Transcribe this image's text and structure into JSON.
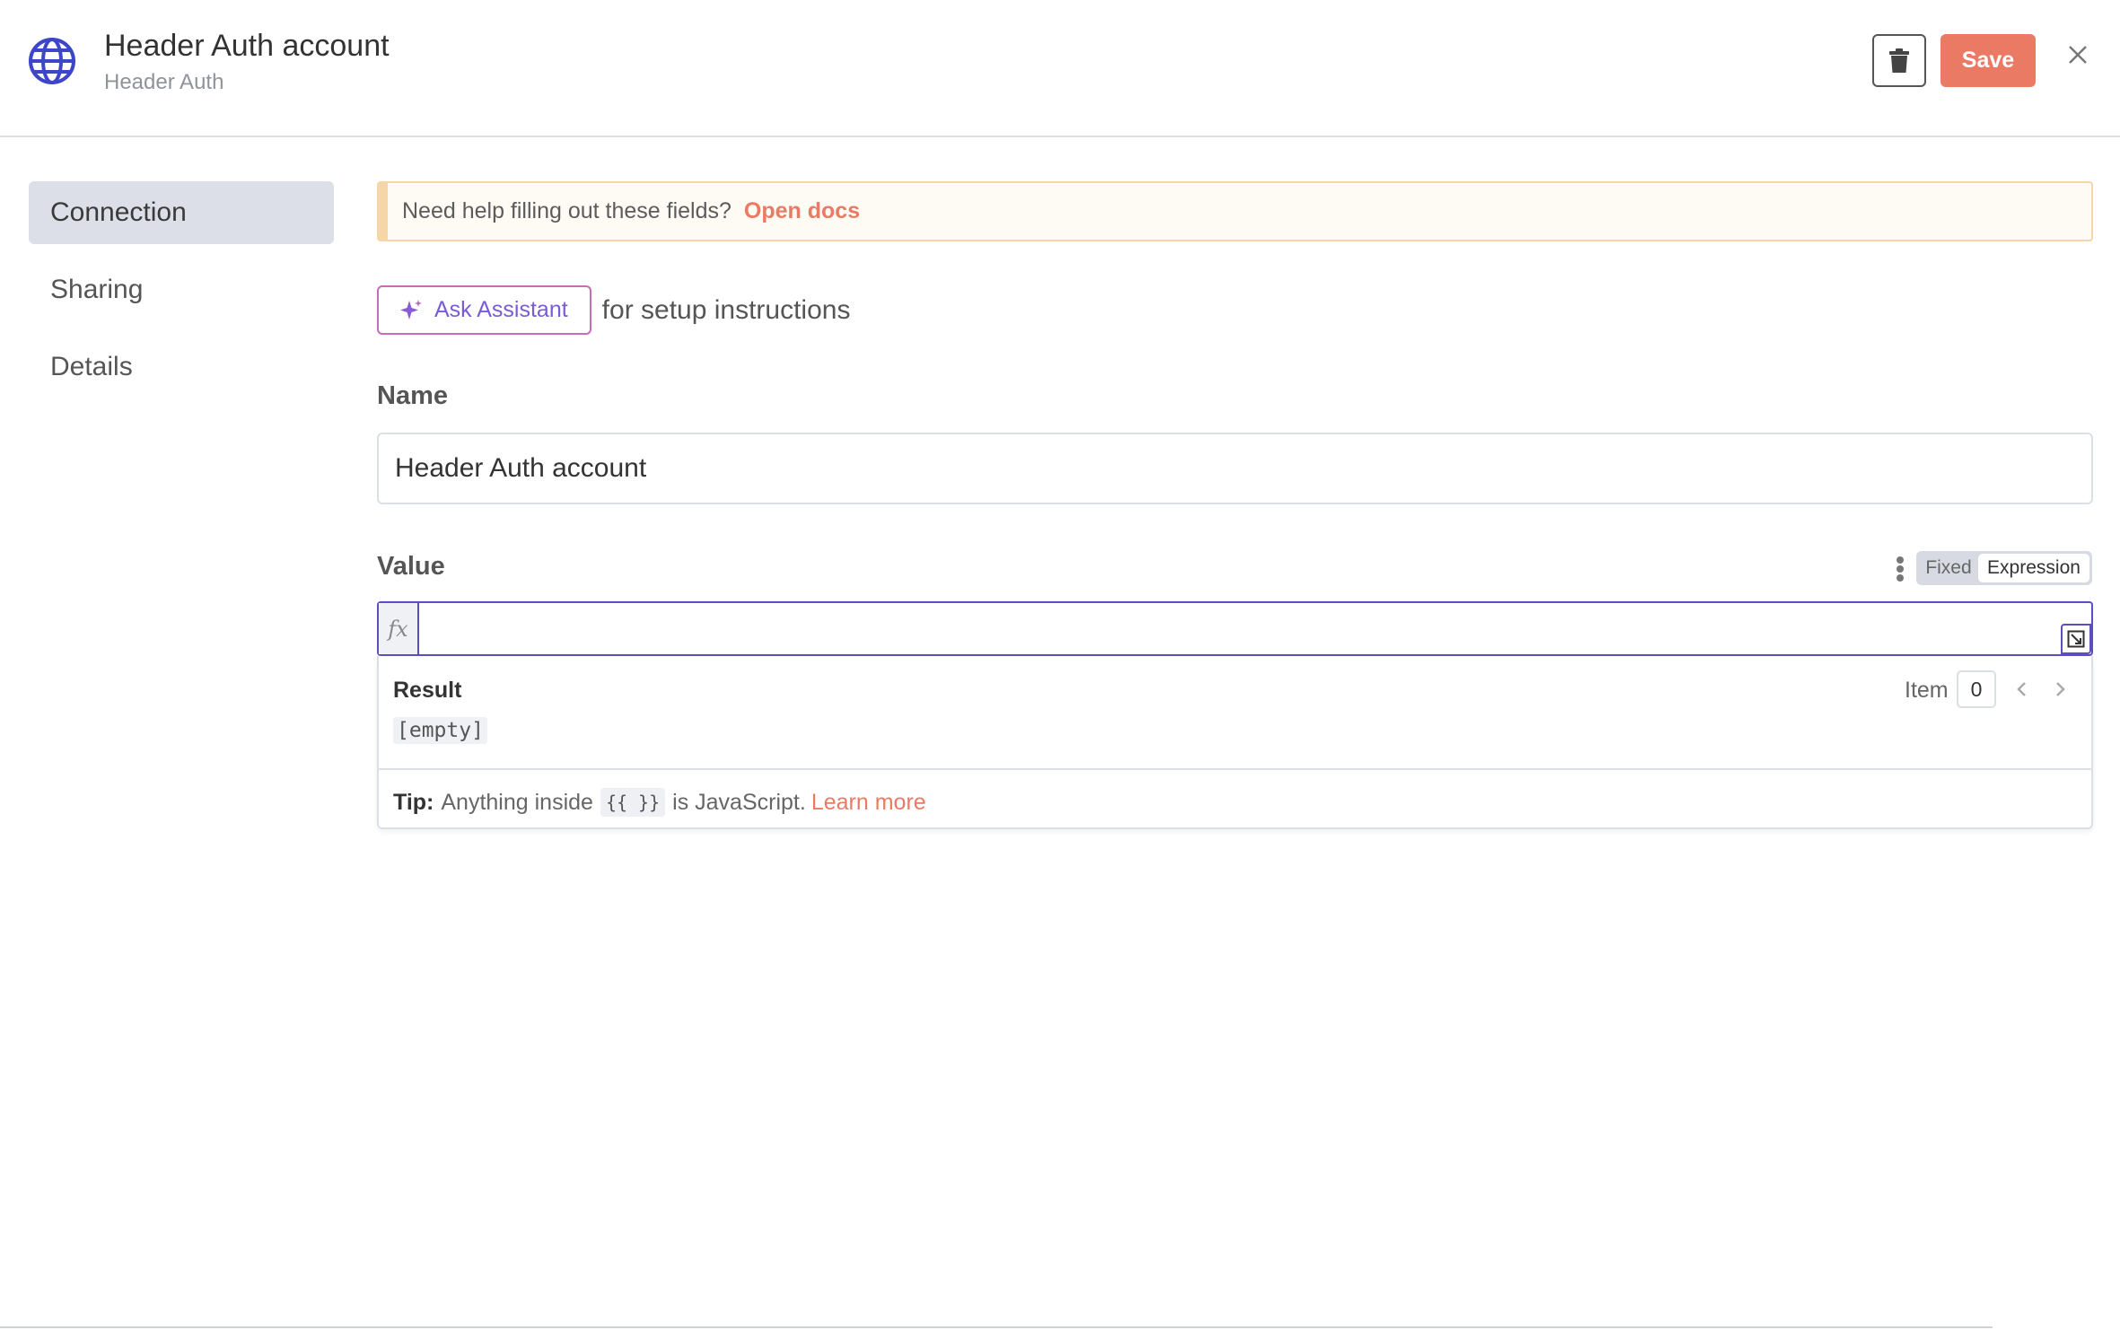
{
  "header": {
    "icon": "globe-icon",
    "title": "Header Auth account",
    "subtitle": "Header Auth",
    "delete_icon": "trash-icon",
    "save_label": "Save",
    "close_icon": "close-icon"
  },
  "sidebar": {
    "items": [
      {
        "label": "Connection",
        "active": true
      },
      {
        "label": "Sharing",
        "active": false
      },
      {
        "label": "Details",
        "active": false
      }
    ]
  },
  "callout": {
    "text": "Need help filling out these fields?",
    "link": "Open docs"
  },
  "assistant": {
    "button_label": "Ask Assistant",
    "suffix": "for setup instructions"
  },
  "name_field": {
    "label": "Name",
    "value": "Header Auth account"
  },
  "value_field": {
    "label": "Value",
    "mode_options": [
      "Fixed",
      "Expression"
    ],
    "selected_mode": "Expression",
    "fx_label": "fx",
    "value": ""
  },
  "result": {
    "title": "Result",
    "value": "[empty]",
    "item_label": "Item",
    "item_index": "0"
  },
  "tip": {
    "label": "Tip:",
    "text_before": "Anything inside",
    "code": "{{ }}",
    "text_after": "is JavaScript.",
    "link": "Learn more"
  },
  "colors": {
    "accent": "#ea7a64",
    "expression_border": "#5b4fbf",
    "callout_bg": "#fefaf4",
    "callout_border": "#f6d5a6",
    "active_nav_bg": "#dcdfe7"
  }
}
